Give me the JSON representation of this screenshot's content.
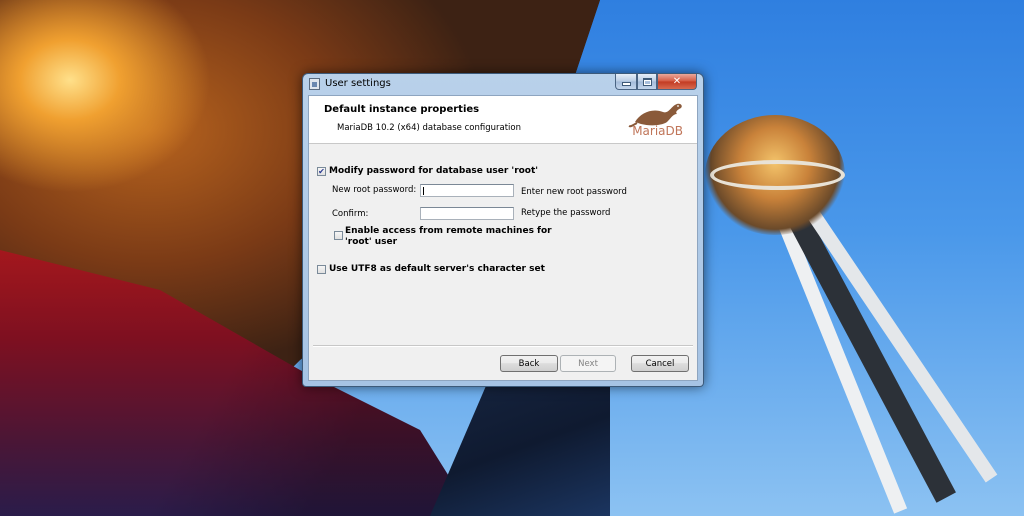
{
  "window": {
    "title": "User settings",
    "controls": {
      "minimize": "minimize-icon",
      "maximize": "maximize-icon",
      "close": "✕"
    }
  },
  "banner": {
    "title": "Default instance properties",
    "subtitle": "MariaDB 10.2 (x64) database configuration",
    "logo_text": "MariaDB"
  },
  "form": {
    "modify_password": {
      "label": "Modify password for database user 'root'",
      "checked": true
    },
    "new_root_password": {
      "label": "New root password:",
      "value": "",
      "hint": "Enter new root password"
    },
    "confirm": {
      "label": "Confirm:",
      "value": "",
      "hint": "Retype the password"
    },
    "remote_access": {
      "label_line1": "Enable access from remote machines for",
      "label_line2": "'root' user",
      "checked": false
    },
    "utf8": {
      "label": "Use UTF8 as default server's character set",
      "checked": false
    }
  },
  "buttons": {
    "back": "Back",
    "next": "Next",
    "next_enabled": false,
    "cancel": "Cancel"
  },
  "colors": {
    "logo": "#c0765a",
    "checkmark": "#2a3a90"
  }
}
